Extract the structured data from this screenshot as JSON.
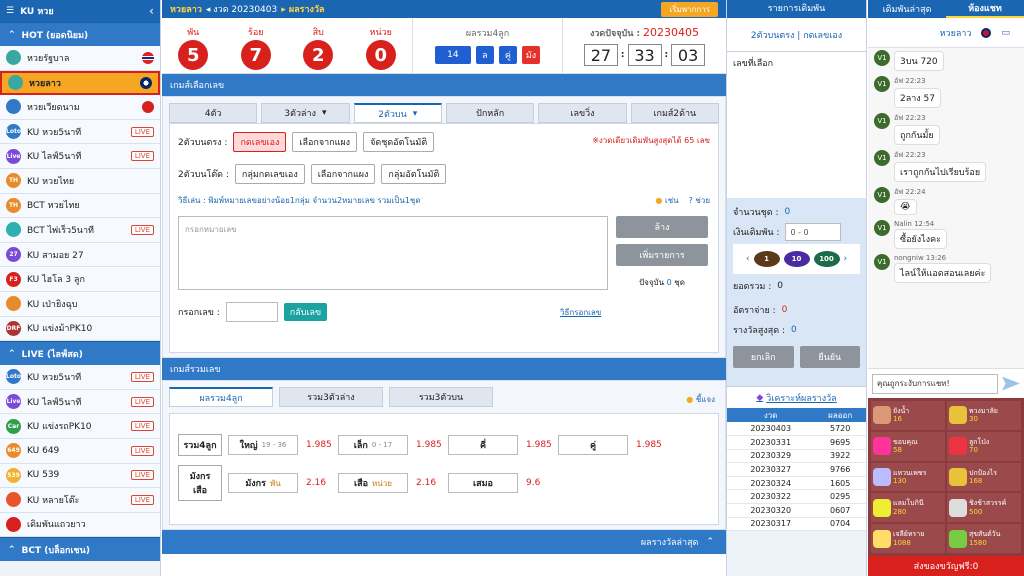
{
  "sidebar": {
    "title": "KU หวย",
    "sections": [
      {
        "label": "HOT (ยอดนิยม)",
        "items": [
          {
            "label": "หวยรัฐบาล",
            "icon": "#3aa8a0",
            "flag": "th"
          },
          {
            "label": "หวยลาว",
            "icon": "#3aa8a0",
            "flag": "la",
            "active": true
          },
          {
            "label": "หวยเวียดนาม",
            "icon": "#2f79c7",
            "flag": "vn"
          },
          {
            "label": "KU หวย5นาที",
            "icon": "#2f79c7",
            "tag": "Loto",
            "live": "LIVE"
          },
          {
            "label": "KU ไลฟ์5นาที",
            "icon": "#7b4ad6",
            "tag": "Live",
            "live": "LIVE"
          },
          {
            "label": "KU หวยไทย",
            "icon": "#e98a2b",
            "tag": "TH"
          },
          {
            "label": "BCT หวยไทย",
            "icon": "#e98a2b",
            "tag": "TH"
          },
          {
            "label": "BCT ไพ่เร็ว5นาที",
            "icon": "#2fb0b0",
            "live": "LIVE"
          },
          {
            "label": "KU สามอย 27",
            "icon": "#7b4ad6",
            "tag": "27"
          },
          {
            "label": "KU ไฮโล 3 ลูก",
            "icon": "#d8201d",
            "tag": "F3"
          },
          {
            "label": "KU เป่ายิงฉุบ",
            "icon": "#e98a2b"
          },
          {
            "label": "KU แข่งม้าPK10",
            "icon": "#a33",
            "tag": "DRF"
          }
        ]
      },
      {
        "label": "LIVE (ไลฟ์สด)",
        "items": [
          {
            "label": "KU หวย5นาที",
            "icon": "#2f79c7",
            "tag": "Loto",
            "live": "LIVE"
          },
          {
            "label": "KU ไลฟ์5นาที",
            "icon": "#7b4ad6",
            "tag": "Live",
            "live": "LIVE"
          },
          {
            "label": "KU แข่งรถPK10",
            "icon": "#2e9e4a",
            "tag": "Car",
            "live": "LIVE"
          },
          {
            "label": "KU 649",
            "icon": "#e98a2b",
            "tag": "649",
            "live": "LIVE"
          },
          {
            "label": "KU 539",
            "icon": "#f0b030",
            "tag": "539",
            "live": "LIVE"
          },
          {
            "label": "KU หลายโต๊ะ",
            "icon": "#e9552b",
            "live": "LIVE"
          },
          {
            "label": "เดิมพันแถวยาว",
            "icon": "#d8201d"
          }
        ]
      },
      {
        "label": "BCT (บล็อกเชน)",
        "items": []
      }
    ]
  },
  "topbar": {
    "lotto": "หวยลาว",
    "round": "◂ งวด 20230403",
    "draw": "▸ ผลรางวัล",
    "btn": "เริ่มพากการ"
  },
  "result": {
    "digits": [
      {
        "label": "พัน",
        "value": "5"
      },
      {
        "label": "ร้อย",
        "value": "7"
      },
      {
        "label": "สิบ",
        "value": "2"
      },
      {
        "label": "หน่วย",
        "value": "0"
      }
    ],
    "sum_title": "ผลรวม4ลูก",
    "sum_values": [
      "14",
      "ล",
      "คู่",
      "มัง"
    ],
    "round_label": "งวดปัจจุบัน :",
    "round_no": "20230405",
    "cd": [
      "27",
      "33",
      "03"
    ]
  },
  "pick": {
    "bar": "เกมส์เลือกเลข",
    "tabs": [
      "4ตัว",
      "3ตัวล่าง",
      "2ตัวบน",
      "ปักหลัก",
      "เลขวิ่ง",
      "เกมส์2ด้าน"
    ],
    "r1_label": "2ตัวบนตรง :",
    "r1_btns": [
      "กดเลขเอง",
      "เลือกจากแผง",
      "จัดชุดอัตโนมัติ"
    ],
    "note": "※งวดเดียวเดิมพันสูงสุดได้ 65 เลข",
    "r2_label": "2ตัวบนโต๊ด :",
    "r2_btns": [
      "กลุ่มกดเลขเอง",
      "เลือกจากแผง",
      "กลุ่มอัตโนมัติ"
    ],
    "hint": "วิธีเล่น : พิมพ์หมายเลขอย่างน้อย1กลุ่ม จำนวน2หมายเลข รวมเป็น1ชุด",
    "example": "เช่น",
    "help": "ช่วย",
    "placeholder": "กรอกหมายเลข",
    "clear": "ล้าง",
    "add": "เพิ่มรายการ",
    "now": "ปัจจุบัน",
    "now_n": "0",
    "now_u": "ชุด",
    "input_label": "กรอกเลข :",
    "reverse": "กลับเลข",
    "howto": "วิธีกรอกเลข"
  },
  "sum": {
    "bar": "เกมส์รวมเลข",
    "tabs": [
      "ผลรวม4ลูก",
      "รวม3ตัวล่าง",
      "รวม3ตัวบน"
    ],
    "rules": "ชี้แจง",
    "row1": {
      "label": "รวม4ลูก",
      "b": [
        {
          "t": "ใหญ่",
          "s": "19 - 36",
          "o": "1.985"
        },
        {
          "t": "เล็ก",
          "s": "0 - 17",
          "o": "1.985"
        },
        {
          "t": "คี่",
          "o": "1.985"
        },
        {
          "t": "คู่",
          "o": "1.985"
        }
      ]
    },
    "row2": {
      "label": "มังกรเสือ",
      "b": [
        {
          "t": "มังกร",
          "s": "พัน",
          "o": "2.16"
        },
        {
          "t": "เสือ",
          "s": "หน่วย",
          "o": "2.16"
        },
        {
          "t": "เสมอ",
          "o": "9.6"
        }
      ]
    },
    "foot": "ผลรางวัลล่าสุด"
  },
  "bets": {
    "title": "รายการเดิมพัน",
    "sub": "2ตัวบนตรง | กดเลขเอง",
    "picked": "เลขที่เลือก",
    "sets": "จำนวนชุด :",
    "sets_v": "0",
    "amount": "เงินเดิมพัน :",
    "amount_v": "0 - 0",
    "chips": [
      "1",
      "10",
      "100"
    ],
    "total": "ยอดรวม :",
    "total_v": "0",
    "rate": "อัตราจ่าย :",
    "rate_v": "0",
    "max": "รางวัลสูงสุด :",
    "max_v": "0",
    "cancel": "ยกเลิก",
    "confirm": "ยืนยัน",
    "analyze": "วิเคราะห์ผลรางวัล",
    "th": [
      "งวด",
      "ผลออก"
    ],
    "rows": [
      [
        "20230403",
        "5720"
      ],
      [
        "20230331",
        "9695"
      ],
      [
        "20230329",
        "3922"
      ],
      [
        "20230327",
        "9766"
      ],
      [
        "20230324",
        "1605"
      ],
      [
        "20230322",
        "0295"
      ],
      [
        "20230320",
        "0607"
      ],
      [
        "20230317",
        "0704"
      ]
    ]
  },
  "chat": {
    "tabs": [
      "เดิมพันล่าสุด",
      "ห้องแชท"
    ],
    "room": "หวยลาว",
    "msgs": [
      {
        "who": "",
        "txt": "3บน 720"
      },
      {
        "who": "อัฟ 22:23",
        "txt": "2ลาง 57"
      },
      {
        "who": "อัฟ 22:23",
        "txt": "ถูกกันมั้ย"
      },
      {
        "who": "อัฟ 22:23",
        "txt": "เราถูกกันไปเรียบร้อย"
      },
      {
        "who": "อัฟ 22:24",
        "txt": "😭"
      },
      {
        "who": "Nalin 12:54",
        "txt": "ซื้อยังไงคะ"
      },
      {
        "who": "nongniw 13:26",
        "txt": "ไลน์ให้แอดสอนเลยค่ะ"
      }
    ],
    "av": "V1",
    "input": "คุณถูกระงับการแชท!",
    "gifts": [
      {
        "n": "ยังน้ำ",
        "v": "16",
        "c": "#d97"
      },
      {
        "n": "พวงมาลัย",
        "v": "30",
        "c": "#e9c23b"
      },
      {
        "n": "ขอบคุณ",
        "v": "58",
        "c": "#f39"
      },
      {
        "n": "ลูกโป่ง",
        "v": "70",
        "c": "#e34"
      },
      {
        "n": "แหวนเพชร",
        "v": "130",
        "c": "#bbf"
      },
      {
        "n": "ปกป้องไร",
        "v": "168",
        "c": "#e9c23b"
      },
      {
        "n": "แลมโบกินี",
        "v": "280",
        "c": "#ee3"
      },
      {
        "n": "ชิงช้าสวรรค์",
        "v": "500",
        "c": "#ddd"
      },
      {
        "n": "เจลีย์ทราย",
        "v": "1088",
        "c": "#fd6"
      },
      {
        "n": "สุขสันต์วัน",
        "v": "1580",
        "c": "#7c4"
      }
    ],
    "gifts_foot": "ส่งของขวัญฟรี:0"
  }
}
